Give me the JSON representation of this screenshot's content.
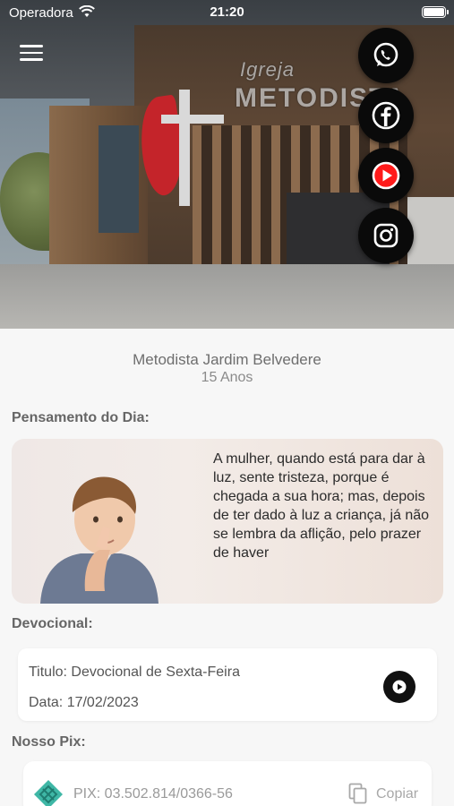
{
  "status_bar": {
    "carrier": "Operadora",
    "time": "21:20"
  },
  "social": [
    {
      "name": "whatsapp-icon"
    },
    {
      "name": "facebook-icon"
    },
    {
      "name": "youtube-icon"
    },
    {
      "name": "instagram-icon"
    }
  ],
  "hero": {
    "sign_top": "Igreja",
    "sign_main": "METODISTA"
  },
  "church": {
    "name": "Metodista Jardim Belvedere",
    "subtitle": "15 Anos"
  },
  "thought": {
    "heading": "Pensamento do Dia:",
    "text": "A mulher, quando está para dar à luz, sente tristeza, porque é chegada a sua hora; mas, depois de ter dado à luz a criança, já não se lembra da aflição, pelo prazer de haver"
  },
  "devotional": {
    "heading": "Devocional:",
    "title": "Titulo: Devocional de Sexta-Feira",
    "date": "Data: 17/02/2023"
  },
  "pix": {
    "heading": "Nosso Pix:",
    "key": "PIX: 03.502.814/0366-56",
    "copy_label": "Copiar"
  },
  "colors": {
    "youtube": "#ff1a1a",
    "pix": "#3fb7a6",
    "heading": "#666666"
  }
}
